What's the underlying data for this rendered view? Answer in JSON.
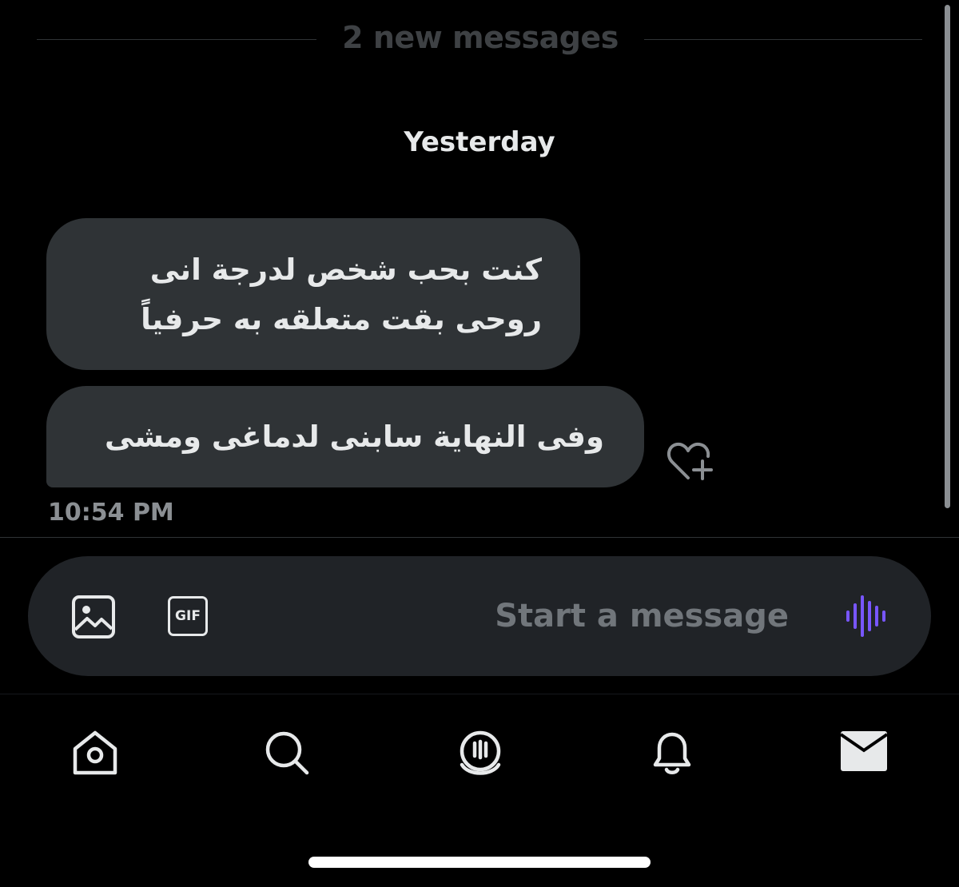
{
  "divider": {
    "new_messages": "2 new messages"
  },
  "date_separator": "Yesterday",
  "messages": [
    {
      "lines": [
        "كنت بحب شخص لدرجة انى",
        "روحى بقت متعلقه به حرفياً"
      ]
    },
    {
      "lines": [
        "وفى النهاية سابنى لدماغى ومشى"
      ]
    }
  ],
  "timestamp": "10:54 PM",
  "composer": {
    "placeholder": "Start a message",
    "gif_label": "GIF",
    "media_icon": "image-icon",
    "voice_icon": "voice-waveform-icon",
    "voice_color": "#7856ff"
  },
  "nav": {
    "items": [
      "home-icon",
      "search-icon",
      "spaces-icon",
      "bell-icon",
      "envelope-icon"
    ]
  },
  "colors": {
    "background": "#000000",
    "bubble": "#2f3336",
    "text": "#e7e9ea",
    "muted": "#71767b"
  }
}
